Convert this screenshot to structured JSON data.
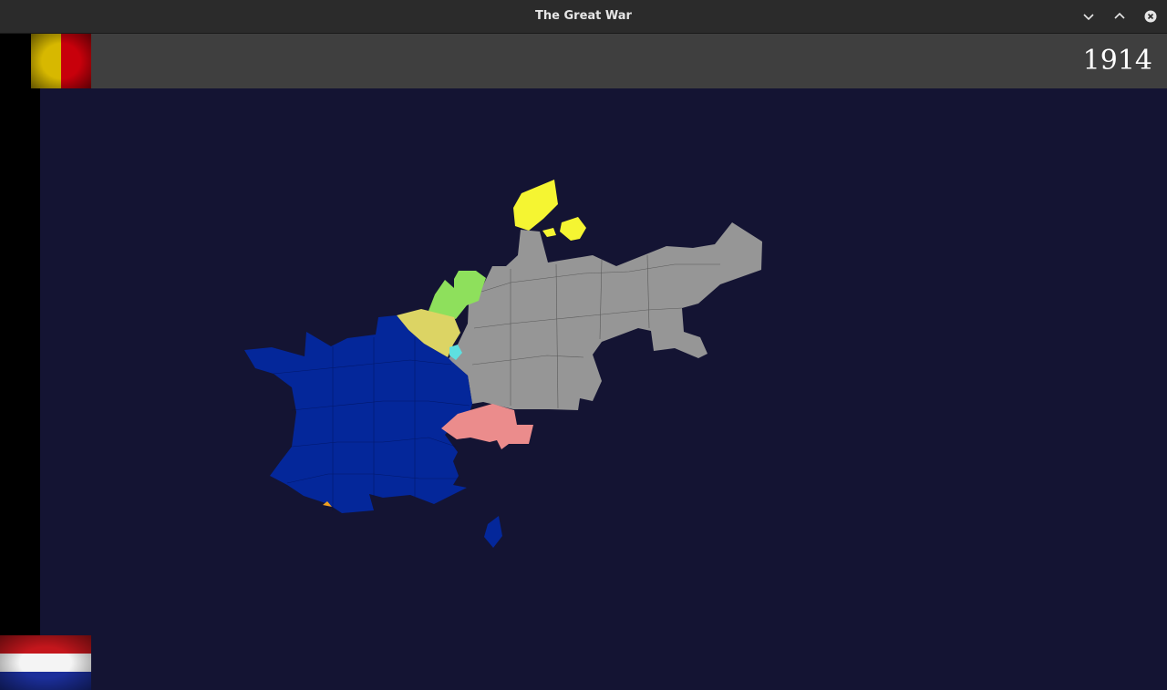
{
  "window": {
    "title": "The Great War"
  },
  "hud": {
    "year": "1914"
  },
  "flags": {
    "player": {
      "country": "Belgium",
      "colors": [
        "#d7b800",
        "#c8000b"
      ]
    },
    "other": {
      "country": "Netherlands",
      "colors": [
        "#c4161c",
        "#f4f4f4",
        "#1b2e9a"
      ]
    }
  },
  "map": {
    "background": "#141433",
    "regions": [
      {
        "name": "Denmark",
        "color": "#f5f532"
      },
      {
        "name": "Germany",
        "color": "#969696"
      },
      {
        "name": "Netherlands",
        "color": "#8ee05c"
      },
      {
        "name": "Belgium",
        "color": "#dcd464"
      },
      {
        "name": "Luxembourg",
        "color": "#5ee0e0"
      },
      {
        "name": "France",
        "color": "#04279a"
      },
      {
        "name": "Switzerland",
        "color": "#eb8c8c"
      },
      {
        "name": "Corsica",
        "color": "#04279a"
      },
      {
        "name": "Andorra",
        "color": "#f0a020"
      }
    ]
  }
}
